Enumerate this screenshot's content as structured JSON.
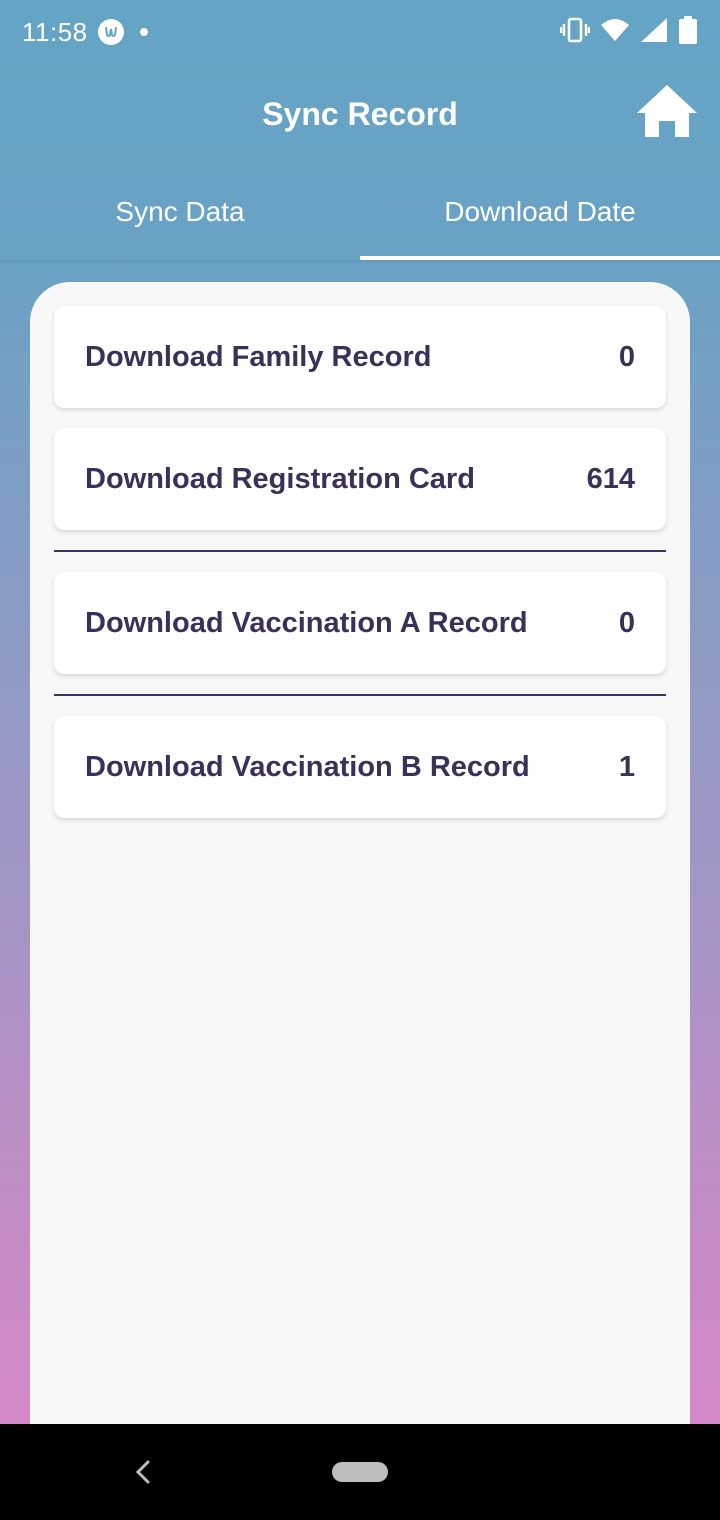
{
  "status_bar": {
    "time": "11:58",
    "icons": [
      "app-notification-icon",
      "dot-icon",
      "vibrate-icon",
      "wifi-icon",
      "signal-icon",
      "battery-icon"
    ]
  },
  "app_bar": {
    "title": "Sync Record",
    "home_icon": "home-icon"
  },
  "tabs": [
    {
      "label": "Sync Data",
      "active": false
    },
    {
      "label": "Download Date",
      "active": true
    }
  ],
  "records": [
    {
      "label": "Download Family Record",
      "count": "0"
    },
    {
      "label": "Download Registration Card",
      "count": "614"
    },
    {
      "label": "Download Vaccination A Record",
      "count": "0"
    },
    {
      "label": "Download Vaccination B Record",
      "count": "1"
    }
  ],
  "colors": {
    "header": "#64a4c4",
    "gradient_bottom": "#d488c8",
    "record_text": "#3a3058",
    "panel": "#f8f8f8"
  },
  "nav_bar": {
    "icons": [
      "back-icon",
      "home-pill-icon"
    ]
  }
}
